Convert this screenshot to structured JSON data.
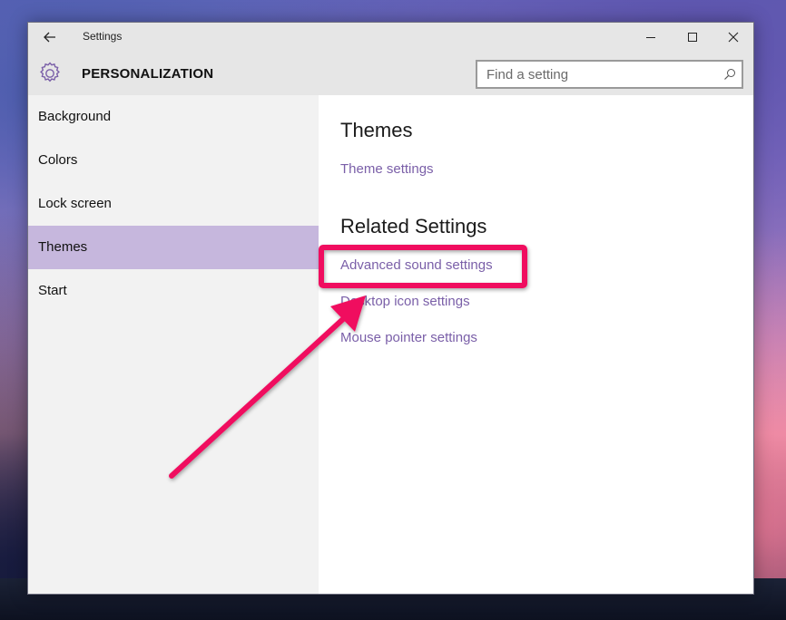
{
  "window": {
    "title": "Settings",
    "heading": "PERSONALIZATION",
    "back_icon": "arrow-left-icon",
    "gear_icon": "gear-icon",
    "controls": [
      "minimize-icon",
      "maximize-icon",
      "close-icon"
    ]
  },
  "search": {
    "placeholder": "Find a setting",
    "value": "",
    "icon": "search-icon"
  },
  "sidebar": {
    "items": [
      {
        "label": "Background",
        "active": false
      },
      {
        "label": "Colors",
        "active": false
      },
      {
        "label": "Lock screen",
        "active": false
      },
      {
        "label": "Themes",
        "active": true
      },
      {
        "label": "Start",
        "active": false
      }
    ]
  },
  "content": {
    "themes_title": "Themes",
    "theme_settings_link": "Theme settings",
    "related_title": "Related Settings",
    "related_links": [
      "Advanced sound settings",
      "Desktop icon settings",
      "Mouse pointer settings"
    ]
  },
  "annotation": {
    "highlight_color": "#f0105f",
    "highlighted_item": "Advanced sound settings"
  },
  "colors": {
    "accent": "#7a5fa8",
    "selected_nav_bg": "#c6b7dd",
    "titlebar_bg": "#e6e6e6",
    "sidebar_bg": "#f2f2f2"
  }
}
